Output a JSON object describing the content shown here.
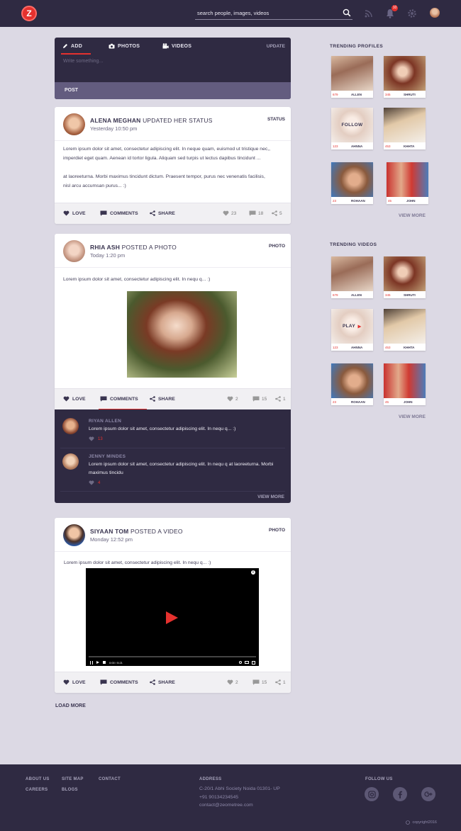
{
  "header": {
    "logo_letter": "Z",
    "search_placeholder": "search people, images, videos",
    "notification_count": "10"
  },
  "composer": {
    "tabs": [
      {
        "label": "ADD"
      },
      {
        "label": "PHOTOS"
      },
      {
        "label": "VIDEOS"
      }
    ],
    "update_label": "UPDATE",
    "textarea_placeholder": "Write something...",
    "post_label": "POST"
  },
  "posts": [
    {
      "author": "ALENA MEGHAN",
      "verb": "updated her status",
      "time": "Yesterday 10:50 pm",
      "type": "STATUS",
      "text1": "Lorem ipsum dolor sit amet, consectetur adipiscing elit. In neque quam, euismod ut tristique nec,,",
      "text2": "imperdiet eget quam. Aenean id tortor ligula. Aliquam sed turpis ut lectus dapibus tincidunt ...",
      "text3": "at laoreeturna. Morbi maximus tincidunt dictum. Praesent tempor, purus nec venenatis facilisis,",
      "text4": "nisl arcu accumsan purus... :)",
      "love": "LOVE",
      "comments": "COMMENTS",
      "share": "SHARE",
      "likes": "23",
      "comment_count": "18",
      "shares": "5"
    },
    {
      "author": "RHIA ASH",
      "verb": "posted a photo",
      "time": "Today 1:20 pm",
      "type": "PHOTO",
      "text1": "Lorem ipsum dolor sit amet, consectetur adipiscing elit. In nequ q... :)",
      "love": "LOVE",
      "comments": "COMMENTS",
      "share": "SHARE",
      "likes": "2",
      "comment_count": "15",
      "shares": "1"
    },
    {
      "author": "SIYAAN TOM",
      "verb": "posted a video",
      "time": "Monday 12:52 pm",
      "type": "PHOTO",
      "text1": "Lorem ipsum dolor sit amet, consectetur adipiscing elit. In nequ q... :)",
      "video_time": "0:00 / 5:21",
      "love": "LOVE",
      "comments": "COMMENTS",
      "share": "SHARE",
      "likes": "2",
      "comment_count": "15",
      "shares": "1"
    }
  ],
  "comments": [
    {
      "name": "RIYAN ALLEN",
      "text": "Lorem ipsum dolor sit amet, consectetur adipiscing elit. In nequ q... :)",
      "likes": "13"
    },
    {
      "name": "JENNY MINDES",
      "text": "Lorem ipsum dolor sit amet, consectetur adipiscing elit. In nequ q at laoreeturna. Morbi maximus tincidu",
      "likes": "4"
    }
  ],
  "comments_view_more": "VIEW MORE",
  "load_more": "LOAD MORE",
  "sidebar": {
    "profiles_title": "TRENDING PROFILES",
    "videos_title": "TRENDING VIDEOS",
    "view_more": "VIEW MORE",
    "follow_label": "FOLLOW",
    "play_label": "PLAY",
    "profiles": [
      {
        "count": "679",
        "name": "ALLEN"
      },
      {
        "count": "345",
        "name": "SHRUTI"
      },
      {
        "count": "123",
        "name": "AHNNA"
      },
      {
        "count": "453",
        "name": "KHHTA"
      },
      {
        "count": "23",
        "name": "ROHAAN"
      },
      {
        "count": "45",
        "name": "JOHN"
      }
    ],
    "videos": [
      {
        "count": "679",
        "name": "ALLEN"
      },
      {
        "count": "345",
        "name": "SHRUTI"
      },
      {
        "count": "123",
        "name": "AHNNA"
      },
      {
        "count": "453",
        "name": "KHHTA"
      },
      {
        "count": "23",
        "name": "ROHAAN"
      },
      {
        "count": "45",
        "name": "JOHN"
      }
    ]
  },
  "footer": {
    "links": [
      "ABOUT US",
      "SITE MAP",
      "CONTACT",
      "CAREERS",
      "BLOGS"
    ],
    "address_title": "ADDRESS",
    "address_line": "C-20/1 Abhi Society Noida 01301- UP",
    "phone": "+91 90134234545",
    "email": "contact@zeometree.com",
    "follow_title": "FOLLOW US",
    "copyright": "copyright2016"
  },
  "colors": {
    "accent": "#e5312e",
    "dark": "#2f2a42",
    "page": "#dcd9e4"
  }
}
